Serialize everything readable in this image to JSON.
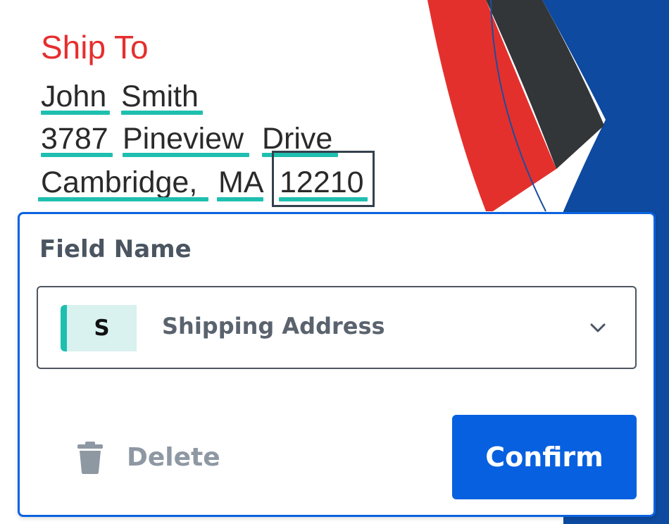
{
  "document": {
    "heading": "Ship To",
    "address_words": [
      "John",
      "Smith",
      "3787",
      "Pineview",
      "Drive",
      "Cambridge,",
      "MA",
      "12210"
    ]
  },
  "field_popup": {
    "label": "Field Name",
    "select": {
      "badge_letter": "S",
      "value": "Shipping Address",
      "icon": "chevron-down-icon"
    },
    "delete_label": "Delete",
    "delete_icon": "trash-icon",
    "confirm_label": "Confirm"
  },
  "colors": {
    "heading": "#e62e2e",
    "highlight_underline": "#1fbfb0",
    "card_border": "#0a63e0",
    "confirm_button": "#0760e0",
    "badge_bg": "#d9f1ef"
  }
}
